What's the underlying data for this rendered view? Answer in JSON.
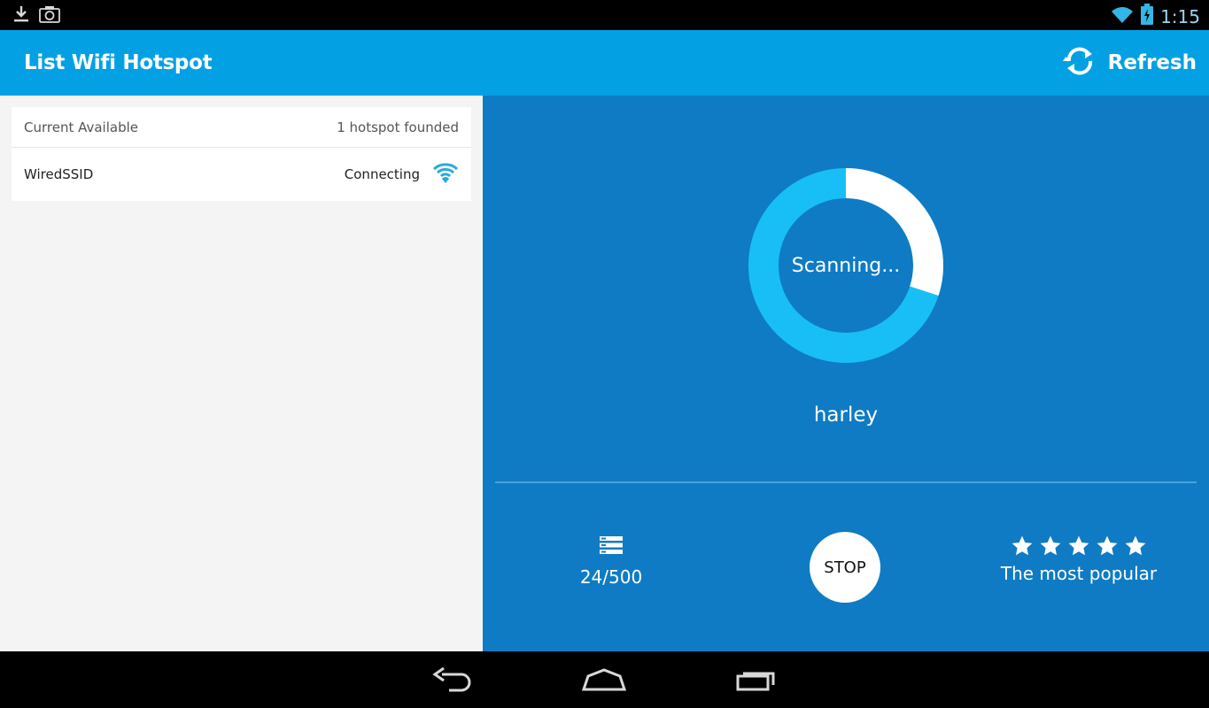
{
  "status_bar": {
    "time": "1:15",
    "icons": [
      "download-icon",
      "screenshot-icon",
      "wifi-icon",
      "battery-charging-icon"
    ]
  },
  "action_bar": {
    "title": "List Wifi Hotspot",
    "refresh_label": "Refresh",
    "refresh_icon": "refresh-icon"
  },
  "hotspot_list": {
    "header_left": "Current Available",
    "header_right": "1 hotspot founded",
    "items": [
      {
        "name": "WiredSSID",
        "status": "Connecting",
        "icon": "wifi-signal-icon"
      }
    ]
  },
  "scanner": {
    "progress_label": "Scanning...",
    "progress_fraction": 0.3,
    "network_name": "harley",
    "count": "24/500",
    "count_icon": "list-icon",
    "stop_label": "STOP",
    "rating_stars": 5,
    "rating_label": "The most popular"
  },
  "colors": {
    "action_bar": "#03a1e4",
    "right_panel": "#0f7bc4",
    "donut_track": "#18bff7",
    "donut_progress": "#ffffff",
    "wifi_icon": "#2aa9e0"
  },
  "nav_bar": {
    "icons": [
      "back-icon",
      "home-icon",
      "recent-apps-icon"
    ]
  }
}
